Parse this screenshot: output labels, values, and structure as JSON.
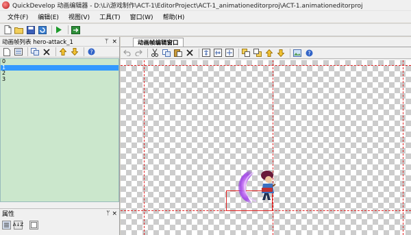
{
  "window": {
    "title": "QuickDevelop 动画编辑器 - D:\\Li\\游戏制作\\ACT-1\\EditorProject\\ACT-1_animationeditorproj\\ACT-1.animationeditorproj"
  },
  "menu": [
    {
      "label": "文件(F)"
    },
    {
      "label": "编辑(E)"
    },
    {
      "label": "视图(V)"
    },
    {
      "label": "工具(T)"
    },
    {
      "label": "窗口(W)"
    },
    {
      "label": "帮助(H)"
    }
  ],
  "main_toolbar": [
    "new-file-icon",
    "open-folder-icon",
    "save-icon",
    "refresh-icon",
    "play-icon",
    "export-icon"
  ],
  "frame_panel": {
    "title": "动画帧列表 hero-attack_1",
    "pin": "ᛘ",
    "close": "×",
    "frames": [
      "0",
      "1",
      "2",
      "3"
    ],
    "selected_index": 1
  },
  "props_panel": {
    "title": "属性",
    "pin": "ᛘ",
    "close": "×",
    "sort_alpha": "A↓Z"
  },
  "editor": {
    "tab_label": "动画帧编辑窗口"
  },
  "colors": {
    "list_bg": "#cbe7cc",
    "selection": "#3399ff",
    "guide": "#e02020"
  }
}
